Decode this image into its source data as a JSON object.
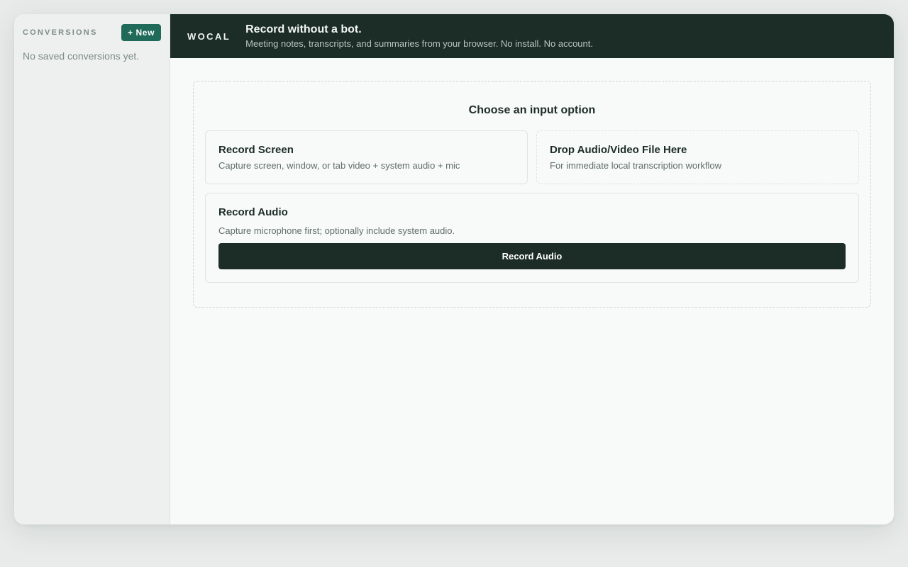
{
  "sidebar": {
    "title": "CONVERSIONS",
    "new_button": "+ New",
    "empty_text": "No saved conversions yet."
  },
  "header": {
    "brand": "WOCAL",
    "tagline": "Record without a bot.",
    "subtitle": "Meeting notes, transcripts, and summaries from your browser. No install. No account."
  },
  "main": {
    "panel_title": "Choose an input option",
    "options": [
      {
        "title": "Record Screen",
        "description": "Capture screen, window, or tab video + system audio + mic"
      },
      {
        "title": "Drop Audio/Video File Here",
        "description": "For immediate local transcription workflow"
      }
    ],
    "audio": {
      "title": "Record Audio",
      "description": "Capture microphone first; optionally include system audio.",
      "button": "Record Audio"
    }
  },
  "colors": {
    "accent": "#1f6a58",
    "header_bg": "#1c2d28",
    "background": "#e8ebea"
  }
}
